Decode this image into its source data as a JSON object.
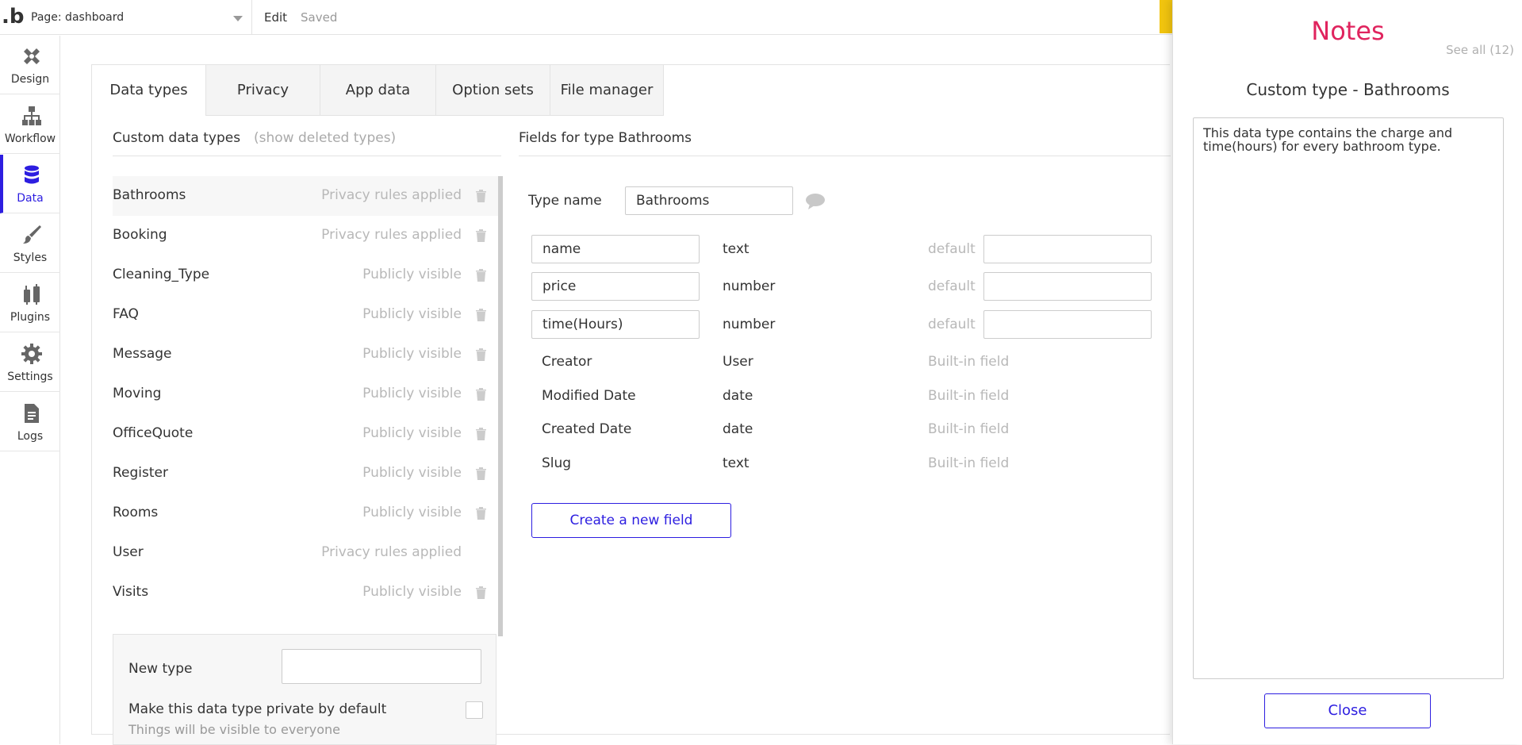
{
  "topbar": {
    "logo": ".b",
    "page_label": "Page: dashboard",
    "edit": "Edit",
    "status": "Saved"
  },
  "rail": [
    {
      "label": "Design",
      "icon": "design-icon"
    },
    {
      "label": "Workflow",
      "icon": "workflow-icon"
    },
    {
      "label": "Data",
      "icon": "database-icon"
    },
    {
      "label": "Styles",
      "icon": "brush-icon"
    },
    {
      "label": "Plugins",
      "icon": "plug-icon"
    },
    {
      "label": "Settings",
      "icon": "gear-icon"
    },
    {
      "label": "Logs",
      "icon": "document-icon"
    }
  ],
  "tabs": [
    "Data types",
    "Privacy",
    "App data",
    "Option sets",
    "File manager"
  ],
  "types_section": {
    "title": "Custom data types",
    "show_deleted": "(show deleted types)"
  },
  "types": [
    {
      "name": "Bathrooms",
      "status": "Privacy rules applied"
    },
    {
      "name": "Booking",
      "status": "Privacy rules applied"
    },
    {
      "name": "Cleaning_Type",
      "status": "Publicly visible"
    },
    {
      "name": "FAQ",
      "status": "Publicly visible"
    },
    {
      "name": "Message",
      "status": "Publicly visible"
    },
    {
      "name": "Moving",
      "status": "Publicly visible"
    },
    {
      "name": "OfficeQuote",
      "status": "Publicly visible"
    },
    {
      "name": "Register",
      "status": "Publicly visible"
    },
    {
      "name": "Rooms",
      "status": "Publicly visible"
    },
    {
      "name": "User",
      "status": "Privacy rules applied"
    },
    {
      "name": "Visits",
      "status": "Publicly visible"
    }
  ],
  "new_type": {
    "label": "New type",
    "private_label": "Make this data type private by default",
    "hint": "Things will be visible to everyone"
  },
  "fields_section": {
    "title": "Fields for type Bathrooms",
    "type_name_label": "Type name",
    "type_name_value": "Bathrooms",
    "default_label": "default",
    "builtin_label": "Built-in field",
    "create_button": "Create a new field"
  },
  "custom_fields": [
    {
      "name": "name",
      "type": "text"
    },
    {
      "name": "price",
      "type": "number"
    },
    {
      "name": "time(Hours)",
      "type": "number"
    }
  ],
  "builtin_fields": [
    {
      "name": "Creator",
      "type": "User"
    },
    {
      "name": "Modified Date",
      "type": "date"
    },
    {
      "name": "Created Date",
      "type": "date"
    },
    {
      "name": "Slug",
      "type": "text"
    }
  ],
  "notes": {
    "title": "Notes",
    "see_all": "See all (12)",
    "subtitle": "Custom type - Bathrooms",
    "body": " This data type contains the charge and time(hours) for every bathroom type.",
    "close": "Close"
  }
}
